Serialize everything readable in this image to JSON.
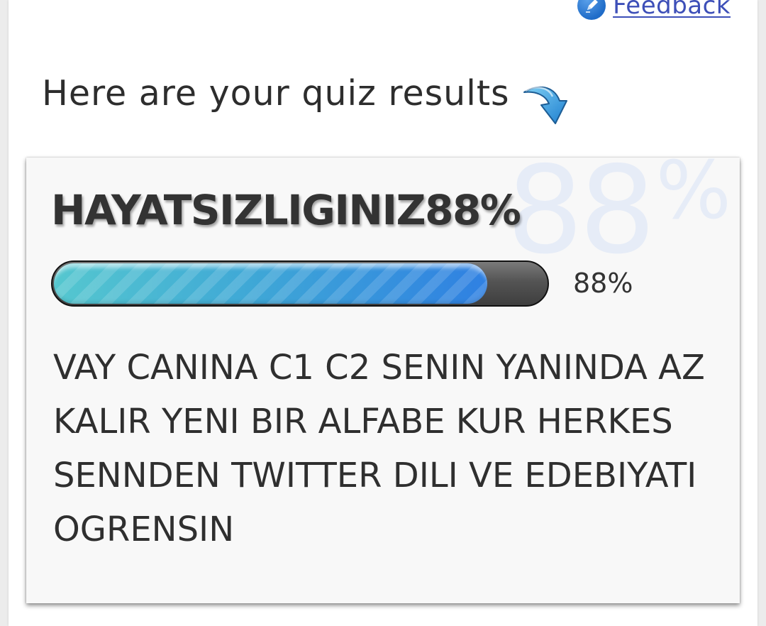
{
  "header": {
    "feedback_label": "Feedback",
    "feedback_icon": "pencil-icon"
  },
  "intro": {
    "text": "Here are your quiz results",
    "icon": "curved-arrow-down-icon"
  },
  "result": {
    "title": "HAYATSIZLIGINIZ88%",
    "watermark_value": "88",
    "watermark_unit": "%",
    "progress_percent": 88,
    "progress_label": "88%",
    "description": "VAY CANINA C1 C2 SENIN YANINDA AZ KALIR YENI BIR ALFABE KUR HERKES SENNDEN TWITTER DILI VE EDEBIYATI OGRENSIN"
  },
  "colors": {
    "link": "#3d4fb8",
    "progress_start": "#55c7cf",
    "progress_end": "#2f80e2",
    "track": "#4a4a4a",
    "watermark": "#e6ecf7"
  }
}
